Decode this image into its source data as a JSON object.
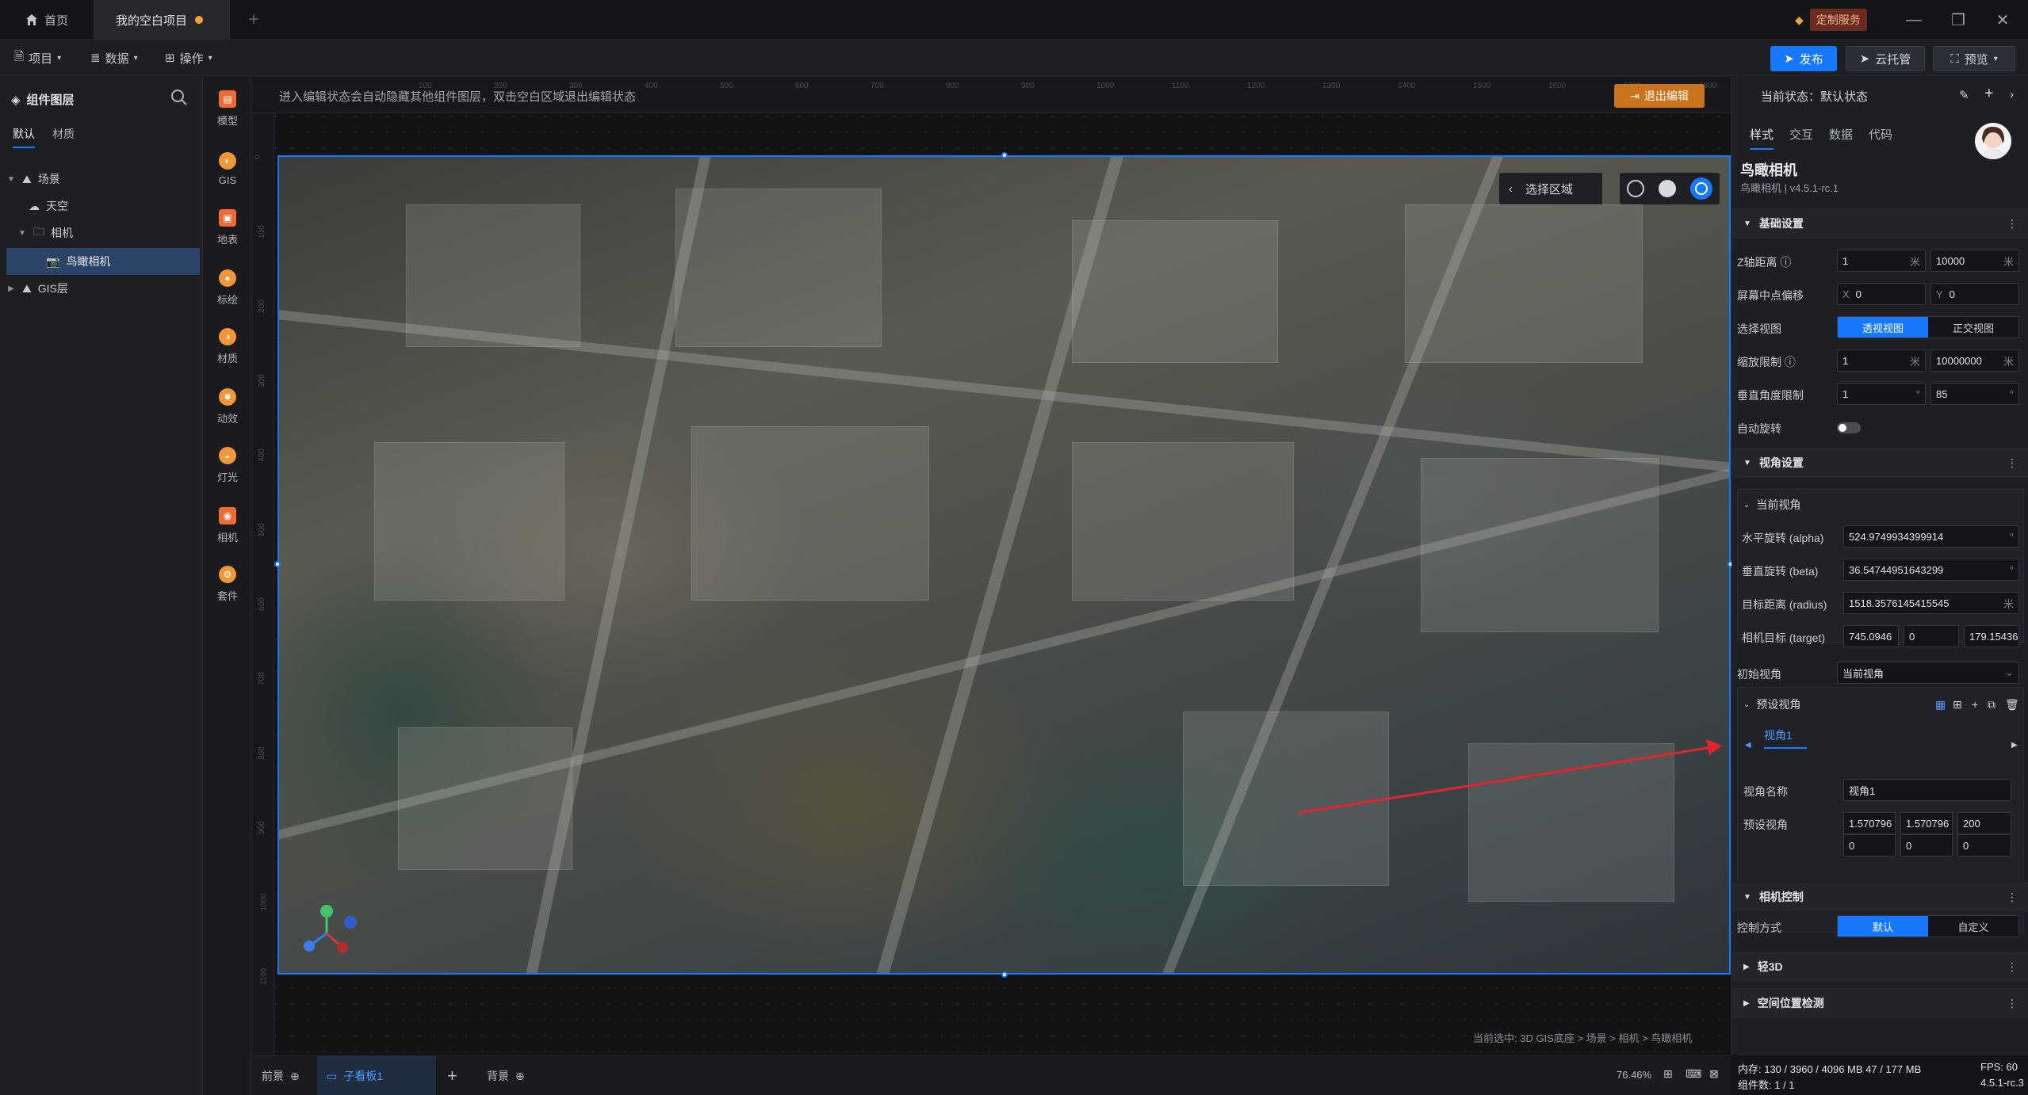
{
  "tabs": {
    "home": "首页",
    "project": "我的空白项目",
    "custom_service": "定制服务"
  },
  "toolbar": {
    "project": "项目",
    "data": "数据",
    "operate": "操作",
    "publish": "发布",
    "cloud": "云托管",
    "preview": "预览"
  },
  "layer_panel": {
    "title": "组件图层",
    "subtabs": [
      "默认",
      "材质"
    ],
    "tree": [
      {
        "label": "场景",
        "icon": "scene-icon"
      },
      {
        "label": "天空",
        "icon": "sky-icon"
      },
      {
        "label": "相机",
        "icon": "folder-icon"
      },
      {
        "label": "鸟瞰相机",
        "icon": "camera-icon"
      },
      {
        "label": "GIS层",
        "icon": "gis-layer-icon"
      }
    ]
  },
  "icon_column": [
    "模型",
    "GIS",
    "地表",
    "标绘",
    "材质",
    "动效",
    "灯光",
    "相机",
    "套件"
  ],
  "canvas": {
    "hint": "进入编辑状态会自动隐藏其他组件图层，双击空白区域退出编辑状态",
    "exit_edit": "退出编辑",
    "select_region": "选择区域",
    "status_path": "当前选中: 3D GIS底座 > 场景 > 相机 > 鸟瞰相机",
    "ruler_h": [
      "100",
      "200",
      "300",
      "400",
      "500",
      "600",
      "700",
      "800",
      "900",
      "1000",
      "1100",
      "1200",
      "1300",
      "1400",
      "1500",
      "1600",
      "1700",
      "1800"
    ],
    "ruler_v": [
      "0",
      "100",
      "200",
      "300",
      "400",
      "500",
      "600",
      "700",
      "800",
      "900",
      "1000",
      "1100"
    ]
  },
  "bottom_bar": {
    "front": "前景",
    "sub": "子看板1",
    "back": "背景",
    "zoom": "76.46%"
  },
  "right_panel": {
    "state": "当前状态：默认状态",
    "tabs": [
      "样式",
      "交互",
      "数据",
      "代码"
    ],
    "comp_name": "鸟瞰相机",
    "comp_version": "鸟瞰相机 | v4.5.1-rc.1",
    "basic": {
      "title": "基础设置",
      "z_label": "Z轴距离",
      "z_min": "1",
      "z_max": "10000",
      "unit_m": "米",
      "offset_label": "屏幕中点偏移",
      "offset_x": "0",
      "offset_y": "0",
      "view_label": "选择视图",
      "view_opts": [
        "透视视图",
        "正交视图"
      ],
      "scale_label": "缩放限制",
      "scale_min": "1",
      "scale_max": "10000000",
      "vert_label": "垂直角度限制",
      "vert_min": "1",
      "vert_max": "85",
      "unit_deg": "°",
      "auto_rotate": "自动旋转"
    },
    "view": {
      "title": "视角设置",
      "current": "当前视角",
      "alpha_label": "水平旋转 (alpha)",
      "alpha": "524.9749934399914",
      "beta_label": "垂直旋转 (beta)",
      "beta": "36.54744951643299",
      "radius_label": "目标距离 (radius)",
      "radius": "1518.3576145415545",
      "target_label": "相机目标 (target)",
      "target_x": "745.0946",
      "target_y": "0",
      "target_z": "179.15436",
      "init_label": "初始视角",
      "init_value": "当前视角",
      "preset": "预设视角",
      "view1": "视角1",
      "name_label": "视角名称",
      "name_value": "视角1",
      "preset_label": "预设视角",
      "p1": "1.570796",
      "p2": "1.570796",
      "p3": "200",
      "p4": "0",
      "p5": "0",
      "p6": "0"
    },
    "camera": {
      "title": "相机控制",
      "mode_label": "控制方式",
      "opts": [
        "默认",
        "自定义"
      ]
    },
    "light3d": "轻3D",
    "space": "空间位置检测",
    "mem": "内存: 130 / 3960 / 4096 MB  47 / 177 MB",
    "fps": "FPS: 60",
    "count": "组件数: 1 / 1",
    "version": "4.5.1-rc.3"
  }
}
